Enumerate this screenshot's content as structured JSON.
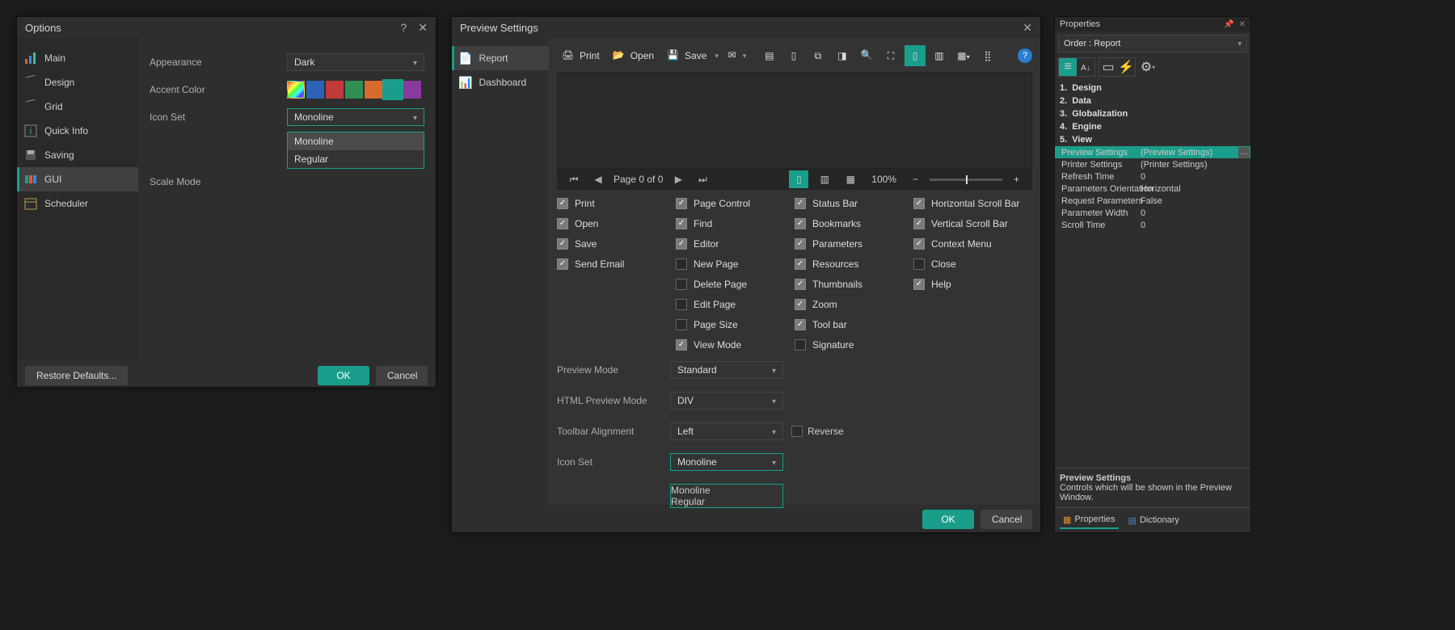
{
  "options": {
    "title": "Options",
    "sidebar": [
      {
        "id": "main",
        "label": "Main",
        "icon": "chart-icon"
      },
      {
        "id": "design",
        "label": "Design",
        "icon": "grid-icon"
      },
      {
        "id": "grid",
        "label": "Grid",
        "icon": "grid-icon"
      },
      {
        "id": "quickinfo",
        "label": "Quick Info",
        "icon": "info-icon"
      },
      {
        "id": "saving",
        "label": "Saving",
        "icon": "save-icon"
      },
      {
        "id": "gui",
        "label": "GUI",
        "icon": "palette-icon",
        "selected": true
      },
      {
        "id": "scheduler",
        "label": "Scheduler",
        "icon": "calendar-icon"
      }
    ],
    "appearance_label": "Appearance",
    "appearance_value": "Dark",
    "accent_label": "Accent Color",
    "accent_colors": [
      "rainbow",
      "#2d63b4",
      "#c13a3a",
      "#2f8f53",
      "#d96a2e",
      "#1a9e8b",
      "#8a3a9e"
    ],
    "accent_selected": 5,
    "iconset_label": "Icon Set",
    "iconset_value": "Monoline",
    "iconset_options": [
      "Monoline",
      "Regular"
    ],
    "iconset_open": true,
    "scalemode_label": "Scale Mode",
    "restore": "Restore Defaults...",
    "ok": "OK",
    "cancel": "Cancel"
  },
  "preview": {
    "title": "Preview Settings",
    "sidebar": [
      {
        "id": "report",
        "label": "Report",
        "selected": true,
        "icon": "report-icon"
      },
      {
        "id": "dashboard",
        "label": "Dashboard",
        "icon": "dashboard-icon"
      }
    ],
    "toolbar": {
      "print": "Print",
      "open": "Open",
      "save": "Save"
    },
    "nav": {
      "page": "Page 0 of 0",
      "zoom": "100%"
    },
    "checkboxes": {
      "col1": [
        {
          "label": "Print",
          "chk": true
        },
        {
          "label": "Open",
          "chk": true
        },
        {
          "label": "Save",
          "chk": true
        },
        {
          "label": "Send Email",
          "chk": true
        }
      ],
      "col2": [
        {
          "label": "Page Control",
          "chk": true
        },
        {
          "label": "Find",
          "chk": true
        },
        {
          "label": "Editor",
          "chk": true
        },
        {
          "label": "New Page",
          "chk": false
        },
        {
          "label": "Delete Page",
          "chk": false
        },
        {
          "label": "Edit Page",
          "chk": false
        },
        {
          "label": "Page Size",
          "chk": false
        },
        {
          "label": "View Mode",
          "chk": true
        }
      ],
      "col3": [
        {
          "label": "Status Bar",
          "chk": true
        },
        {
          "label": "Bookmarks",
          "chk": true
        },
        {
          "label": "Parameters",
          "chk": true
        },
        {
          "label": "Resources",
          "chk": true
        },
        {
          "label": "Thumbnails",
          "chk": true
        },
        {
          "label": "Zoom",
          "chk": true
        },
        {
          "label": "Tool bar",
          "chk": true
        },
        {
          "label": "Signature",
          "chk": false
        }
      ],
      "col4": [
        {
          "label": "Horizontal Scroll Bar",
          "chk": true
        },
        {
          "label": "Vertical Scroll Bar",
          "chk": true
        },
        {
          "label": "Context Menu",
          "chk": true
        },
        {
          "label": "Close",
          "chk": false
        },
        {
          "label": "Help",
          "chk": true
        }
      ]
    },
    "settings": {
      "preview_mode_label": "Preview Mode",
      "preview_mode_value": "Standard",
      "html_mode_label": "HTML Preview Mode",
      "html_mode_value": "DIV",
      "toolbar_align_label": "Toolbar Alignment",
      "toolbar_align_value": "Left",
      "reverse_label": "Reverse",
      "reverse_checked": false,
      "iconset_label": "Icon Set",
      "iconset_value": "Monoline",
      "iconset_options": [
        "Monoline",
        "Regular"
      ],
      "iconset_open": true
    },
    "ok": "OK",
    "cancel": "Cancel"
  },
  "props": {
    "title": "Properties",
    "subject": "Order : Report",
    "categories": [
      {
        "idx": "1.",
        "name": "Design"
      },
      {
        "idx": "2.",
        "name": "Data"
      },
      {
        "idx": "3.",
        "name": "Globalization"
      },
      {
        "idx": "4.",
        "name": "Engine"
      },
      {
        "idx": "5.",
        "name": "View"
      }
    ],
    "rows": [
      {
        "k": "Preview Settings",
        "v": "(Preview Settings)",
        "sel": true,
        "ellipsis": true
      },
      {
        "k": "Printer Settings",
        "v": "(Printer Settings)"
      },
      {
        "k": "Refresh Time",
        "v": "0"
      },
      {
        "k": "Parameters Orientation",
        "v": "Horizontal"
      },
      {
        "k": "Request Parameters",
        "v": "False"
      },
      {
        "k": "Parameter Width",
        "v": "0"
      },
      {
        "k": "Scroll Time",
        "v": "0"
      }
    ],
    "desc_title": "Preview Settings",
    "desc_text": "Controls which will be shown in the Preview Window.",
    "tab_properties": "Properties",
    "tab_dictionary": "Dictionary"
  }
}
